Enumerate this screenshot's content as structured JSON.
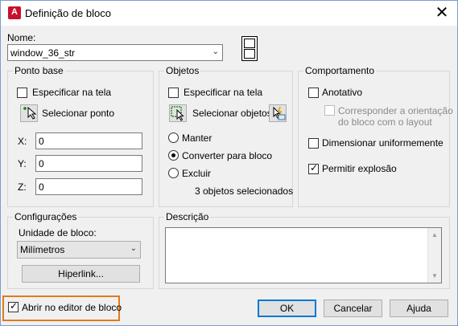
{
  "window": {
    "title": "Definição de bloco",
    "close": "✕"
  },
  "name": {
    "label": "Nome:",
    "value": "window_36_str"
  },
  "base_point": {
    "title": "Ponto base",
    "specify_on_screen": "Especificar na tela",
    "pick_point": "Selecionar ponto",
    "x_label": "X:",
    "x_value": "0",
    "y_label": "Y:",
    "y_value": "0",
    "z_label": "Z:",
    "z_value": "0"
  },
  "objects": {
    "title": "Objetos",
    "specify_on_screen": "Especificar na tela",
    "select_objects": "Selecionar objetos",
    "retain": "Manter",
    "convert": "Converter para bloco",
    "delete": "Excluir",
    "selected_count": "3 objetos selecionados"
  },
  "behavior": {
    "title": "Comportamento",
    "annotative": "Anotativo",
    "match_orientation_line1": "Corresponder a orientação",
    "match_orientation_line2": "do bloco com o layout",
    "scale_uniformly": "Dimensionar uniformemente",
    "allow_exploding": "Permitir explosão"
  },
  "settings": {
    "title": "Configurações",
    "unit_label": "Unidade de bloco:",
    "unit_value": "Milímetros",
    "hyperlink": "Hiperlink..."
  },
  "description": {
    "title": "Descrição"
  },
  "footer": {
    "open_in_editor": "Abrir no editor de bloco",
    "ok": "OK",
    "cancel": "Cancelar",
    "help": "Ajuda"
  },
  "state": {
    "open_in_editor_checked": true,
    "convert_selected": true,
    "allow_exploding_checked": true,
    "annotative_checked": false,
    "scale_uniformly_checked": false
  },
  "colors": {
    "accent": "#0078d7",
    "highlight": "#e07b1a",
    "app_icon": "#c8102e"
  }
}
